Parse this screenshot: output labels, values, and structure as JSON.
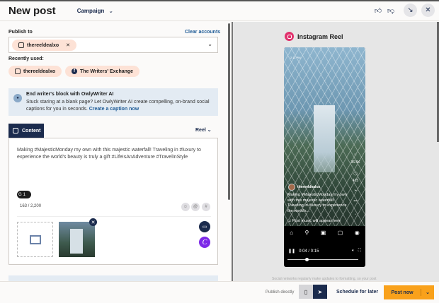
{
  "header": {
    "title": "New post",
    "campaign_label": "Campaign",
    "icons": [
      "thumbs-up-icon",
      "thumbs-down-icon",
      "minimize-icon",
      "close-icon"
    ]
  },
  "publish": {
    "label": "Publish to",
    "clear": "Clear accounts",
    "selected": [
      {
        "name": "thereeldealxo",
        "network": "instagram"
      }
    ],
    "recent_label": "Recently used:",
    "recent": [
      {
        "name": "thereeldealxo",
        "network": "instagram"
      },
      {
        "name": "The Writers' Exchange",
        "network": "facebook"
      }
    ]
  },
  "ai": {
    "title": "End writer's block with OwlyWriter AI",
    "body": "Stuck staring at a blank page? Let OwlyWriter AI create compelling, on-brand social captions for you in seconds.",
    "link": "Create a caption now"
  },
  "content": {
    "tab": "Content",
    "type": "Reel",
    "text": "Making #MajesticMonday my own with this majestic waterfall! Traveling in #luxury to experience the world's beauty is truly a gift #LifeIsAnAdventure #TravelInStyle",
    "grammarly_count": "1",
    "char_count": "163 / 2,200"
  },
  "preview": {
    "label": "Instagram Reel",
    "status_time": "2:11 PM",
    "likes": "36.5K",
    "comments": "425",
    "username": "thereeldealxo",
    "caption": "Making #MajesticMonday my own with this majestic waterfall! Traveling in #luxury to experience the world's...",
    "music": "Post music will appear here",
    "time": "0:04 / 0:15",
    "progress": 0.27,
    "note": "Social networks regularly make updates to formatting, so your post"
  },
  "footer": {
    "publish_directly": "Publish directly",
    "schedule": "Schedule for later",
    "post_now": "Post now"
  },
  "colors": {
    "navy": "#1b2b4d",
    "accent": "#f9a11b",
    "chip": "#fde2d6",
    "instagram": "#e1306c",
    "canva": "#7d2ae8"
  }
}
